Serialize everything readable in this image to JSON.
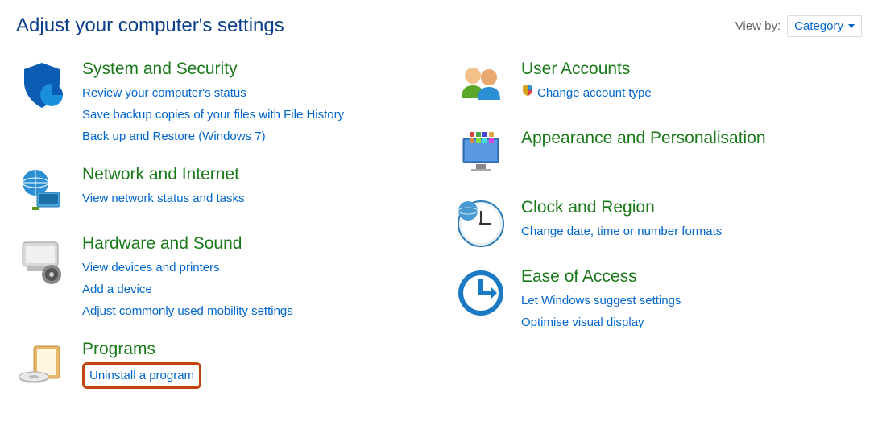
{
  "header": {
    "title": "Adjust your computer's settings",
    "view_by_label": "View by:",
    "view_by_value": "Category"
  },
  "left": [
    {
      "icon": "shield-icon",
      "title": "System and Security",
      "links": [
        {
          "text": "Review your computer's status"
        },
        {
          "text": "Save backup copies of your files with File History"
        },
        {
          "text": "Back up and Restore (Windows 7)"
        }
      ]
    },
    {
      "icon": "network-icon",
      "title": "Network and Internet",
      "links": [
        {
          "text": "View network status and tasks"
        }
      ]
    },
    {
      "icon": "hardware-icon",
      "title": "Hardware and Sound",
      "links": [
        {
          "text": "View devices and printers"
        },
        {
          "text": "Add a device"
        },
        {
          "text": "Adjust commonly used mobility settings"
        }
      ]
    },
    {
      "icon": "programs-icon",
      "title": "Programs",
      "links": [
        {
          "text": "Uninstall a program",
          "highlighted": true
        }
      ]
    }
  ],
  "right": [
    {
      "icon": "users-icon",
      "title": "User Accounts",
      "links": [
        {
          "text": "Change account type",
          "shield": true
        }
      ]
    },
    {
      "icon": "appearance-icon",
      "title": "Appearance and Personalisation",
      "links": []
    },
    {
      "icon": "clock-icon",
      "title": "Clock and Region",
      "links": [
        {
          "text": "Change date, time or number formats"
        }
      ]
    },
    {
      "icon": "ease-icon",
      "title": "Ease of Access",
      "links": [
        {
          "text": "Let Windows suggest settings"
        },
        {
          "text": "Optimise visual display"
        }
      ]
    }
  ]
}
